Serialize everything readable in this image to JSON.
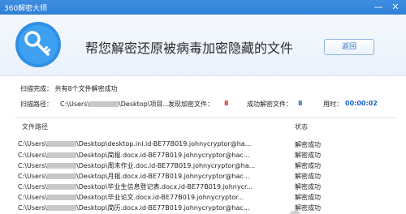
{
  "window": {
    "title": "360解密大师",
    "min_glyph": "—",
    "close_glyph": "✕"
  },
  "header": {
    "headline": "帮您解密还原被病毒加密隐藏的文件",
    "back_label": "返回"
  },
  "summary": {
    "scan_done_label": "扫描完成：",
    "scan_done_text": "共有8个文件解密成功",
    "scan_path_label": "扫描路径：",
    "scan_path_prefix": "C:\\Users\\",
    "scan_path_suffix": "\\Desktop\\项目...",
    "found_label": "发现加密文件：",
    "found_count": "8",
    "success_label": "成功解密文件：",
    "success_count": "8",
    "time_label": "用时：",
    "time_value": "00:00:02"
  },
  "table": {
    "col_path": "文件路径",
    "col_status": "状态",
    "rows": [
      {
        "prefix": "C:\\Users\\",
        "suffix": "\\Desktop\\desktop.ini.id-BE77B019.johnycryptor@ha...",
        "status": "解密成功"
      },
      {
        "prefix": "C:\\Users\\",
        "suffix": "\\Desktop\\简报.docx.id-BE77B019.johnycryptor@hac...",
        "status": "解密成功"
      },
      {
        "prefix": "C:\\Users\\",
        "suffix": "\\Desktop\\周末作业.doc.id-BE77B019.johnycryptor@ha...",
        "status": "解密成功"
      },
      {
        "prefix": "C:\\Users\\",
        "suffix": "\\Desktop\\月报.docx.id-BE77B019.johnycryptor@hac...",
        "status": "解密成功"
      },
      {
        "prefix": "C:\\Users\\",
        "suffix": "\\Desktop\\毕业生信息登记表.docx.id-BE77B019.johnycr...",
        "status": "解密成功"
      },
      {
        "prefix": "C:\\Users\\",
        "suffix": "\\Desktop\\毕业论文.docx.id-BE77B019.johnycryptor...",
        "status": "解密成功"
      },
      {
        "prefix": "C:\\Users\\",
        "suffix": "\\Desktop\\简历.docx.id-BE77B019.johnycryptor@hac...",
        "status": "解密成功"
      }
    ]
  },
  "colors": {
    "titlebar": "#3d8ee3",
    "found_count": "#e02020",
    "success_count": "#1c62c4"
  }
}
